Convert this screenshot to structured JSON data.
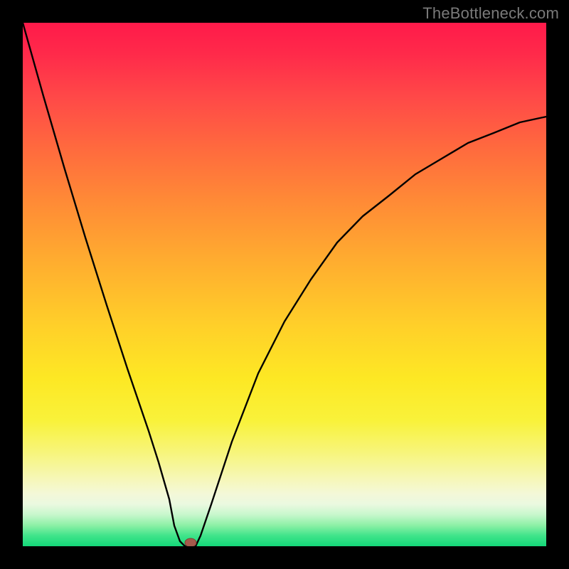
{
  "watermark": {
    "text": "TheBottleneck.com"
  },
  "colors": {
    "frame_bg": "#000000",
    "curve": "#000000",
    "marker_fill": "#a55a4c",
    "marker_stroke": "#7d3f34",
    "gradient_top": "#ff1a4a",
    "gradient_bottom": "#14d879"
  },
  "chart_data": {
    "type": "line",
    "title": "",
    "xlabel": "",
    "ylabel": "",
    "xlim": [
      0,
      100
    ],
    "ylim": [
      0,
      100
    ],
    "notes": "Background heatmap gradient: top=red (worst), bottom=green (best). Curve shows deviation; minimum near x≈32 where marker sits.",
    "grid": false,
    "legend": false,
    "series": [
      {
        "name": "bottleneck-curve",
        "x": [
          0,
          4,
          8,
          12,
          16,
          20,
          24,
          26,
          28,
          29,
          30,
          31,
          32,
          33,
          34,
          36,
          40,
          45,
          50,
          55,
          60,
          65,
          70,
          75,
          80,
          85,
          90,
          95,
          100
        ],
        "values": [
          100,
          86,
          72,
          59,
          46,
          34,
          22,
          16,
          9,
          4,
          1,
          0,
          0,
          0,
          2,
          8,
          20,
          33,
          43,
          51,
          58,
          63,
          67,
          71,
          74,
          77,
          79,
          81,
          82
        ]
      }
    ],
    "optimum_marker": {
      "x": 32,
      "y": 0
    }
  }
}
